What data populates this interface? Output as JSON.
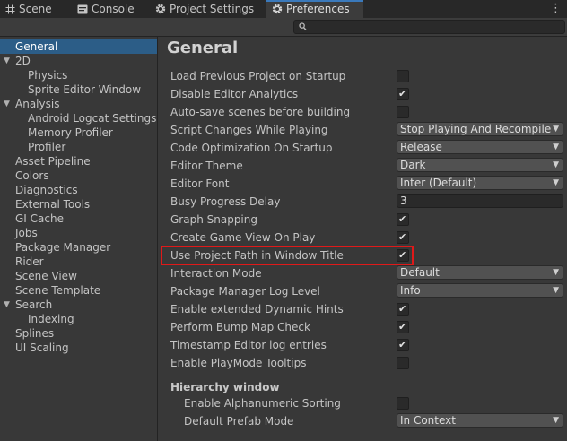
{
  "tabs": [
    {
      "label": "Scene",
      "icon": "scene-grid-icon",
      "active": false
    },
    {
      "label": "Console",
      "icon": "console-icon",
      "active": false
    },
    {
      "label": "Project Settings",
      "icon": "gear-icon",
      "active": false
    },
    {
      "label": "Preferences",
      "icon": "gear-icon",
      "active": true
    }
  ],
  "kebab": "⋮",
  "search": {
    "placeholder": "",
    "value": ""
  },
  "sidebar": {
    "items": [
      {
        "label": "General",
        "level": 0,
        "selected": true,
        "expanded": null
      },
      {
        "label": "2D",
        "level": 0,
        "selected": false,
        "expanded": true
      },
      {
        "label": "Physics",
        "level": 1,
        "selected": false,
        "expanded": null
      },
      {
        "label": "Sprite Editor Window",
        "level": 1,
        "selected": false,
        "expanded": null
      },
      {
        "label": "Analysis",
        "level": 0,
        "selected": false,
        "expanded": true
      },
      {
        "label": "Android Logcat Settings",
        "level": 1,
        "selected": false,
        "expanded": null
      },
      {
        "label": "Memory Profiler",
        "level": 1,
        "selected": false,
        "expanded": null
      },
      {
        "label": "Profiler",
        "level": 1,
        "selected": false,
        "expanded": null
      },
      {
        "label": "Asset Pipeline",
        "level": 0,
        "selected": false,
        "expanded": null
      },
      {
        "label": "Colors",
        "level": 0,
        "selected": false,
        "expanded": null
      },
      {
        "label": "Diagnostics",
        "level": 0,
        "selected": false,
        "expanded": null
      },
      {
        "label": "External Tools",
        "level": 0,
        "selected": false,
        "expanded": null
      },
      {
        "label": "GI Cache",
        "level": 0,
        "selected": false,
        "expanded": null
      },
      {
        "label": "Jobs",
        "level": 0,
        "selected": false,
        "expanded": null
      },
      {
        "label": "Package Manager",
        "level": 0,
        "selected": false,
        "expanded": null
      },
      {
        "label": "Rider",
        "level": 0,
        "selected": false,
        "expanded": null
      },
      {
        "label": "Scene View",
        "level": 0,
        "selected": false,
        "expanded": null
      },
      {
        "label": "Scene Template",
        "level": 0,
        "selected": false,
        "expanded": null
      },
      {
        "label": "Search",
        "level": 0,
        "selected": false,
        "expanded": true
      },
      {
        "label": "Indexing",
        "level": 1,
        "selected": false,
        "expanded": null
      },
      {
        "label": "Splines",
        "level": 0,
        "selected": false,
        "expanded": null
      },
      {
        "label": "UI Scaling",
        "level": 0,
        "selected": false,
        "expanded": null
      }
    ]
  },
  "content": {
    "title": "General",
    "rows": [
      {
        "label": "Load Previous Project on Startup",
        "type": "checkbox",
        "checked": false
      },
      {
        "label": "Disable Editor Analytics",
        "type": "checkbox",
        "checked": true
      },
      {
        "label": "Auto-save scenes before building",
        "type": "checkbox",
        "checked": false
      },
      {
        "label": "Script Changes While Playing",
        "type": "dropdown",
        "value": "Stop Playing And Recompile"
      },
      {
        "label": "Code Optimization On Startup",
        "type": "dropdown",
        "value": "Release"
      },
      {
        "label": "Editor Theme",
        "type": "dropdown",
        "value": "Dark"
      },
      {
        "label": "Editor Font",
        "type": "dropdown",
        "value": "Inter (Default)"
      },
      {
        "label": "Busy Progress Delay",
        "type": "number",
        "value": "3"
      },
      {
        "label": "Graph Snapping",
        "type": "checkbox",
        "checked": true
      },
      {
        "label": "Create Game View On Play",
        "type": "checkbox",
        "checked": true
      },
      {
        "label": "Use Project Path in Window Title",
        "type": "checkbox",
        "checked": true,
        "highlighted": true
      },
      {
        "label": "Interaction Mode",
        "type": "dropdown",
        "value": "Default"
      },
      {
        "label": "Package Manager Log Level",
        "type": "dropdown",
        "value": "Info"
      },
      {
        "label": "Enable extended Dynamic Hints",
        "type": "checkbox",
        "checked": true
      },
      {
        "label": "Perform Bump Map Check",
        "type": "checkbox",
        "checked": true
      },
      {
        "label": "Timestamp Editor log entries",
        "type": "checkbox",
        "checked": true
      },
      {
        "label": "Enable PlayMode Tooltips",
        "type": "checkbox",
        "checked": false
      }
    ],
    "section_title": "Hierarchy window",
    "section_rows": [
      {
        "label": "Enable Alphanumeric Sorting",
        "type": "checkbox",
        "checked": false
      },
      {
        "label": "Default Prefab Mode",
        "type": "dropdown",
        "value": "In Context"
      }
    ]
  },
  "colors": {
    "accent": "#3a79bb",
    "selection": "#2c5d87",
    "highlight_border": "#e01919"
  },
  "glyphs": {
    "check": "✔",
    "caret": "▼",
    "arrow_expanded": "▼"
  }
}
